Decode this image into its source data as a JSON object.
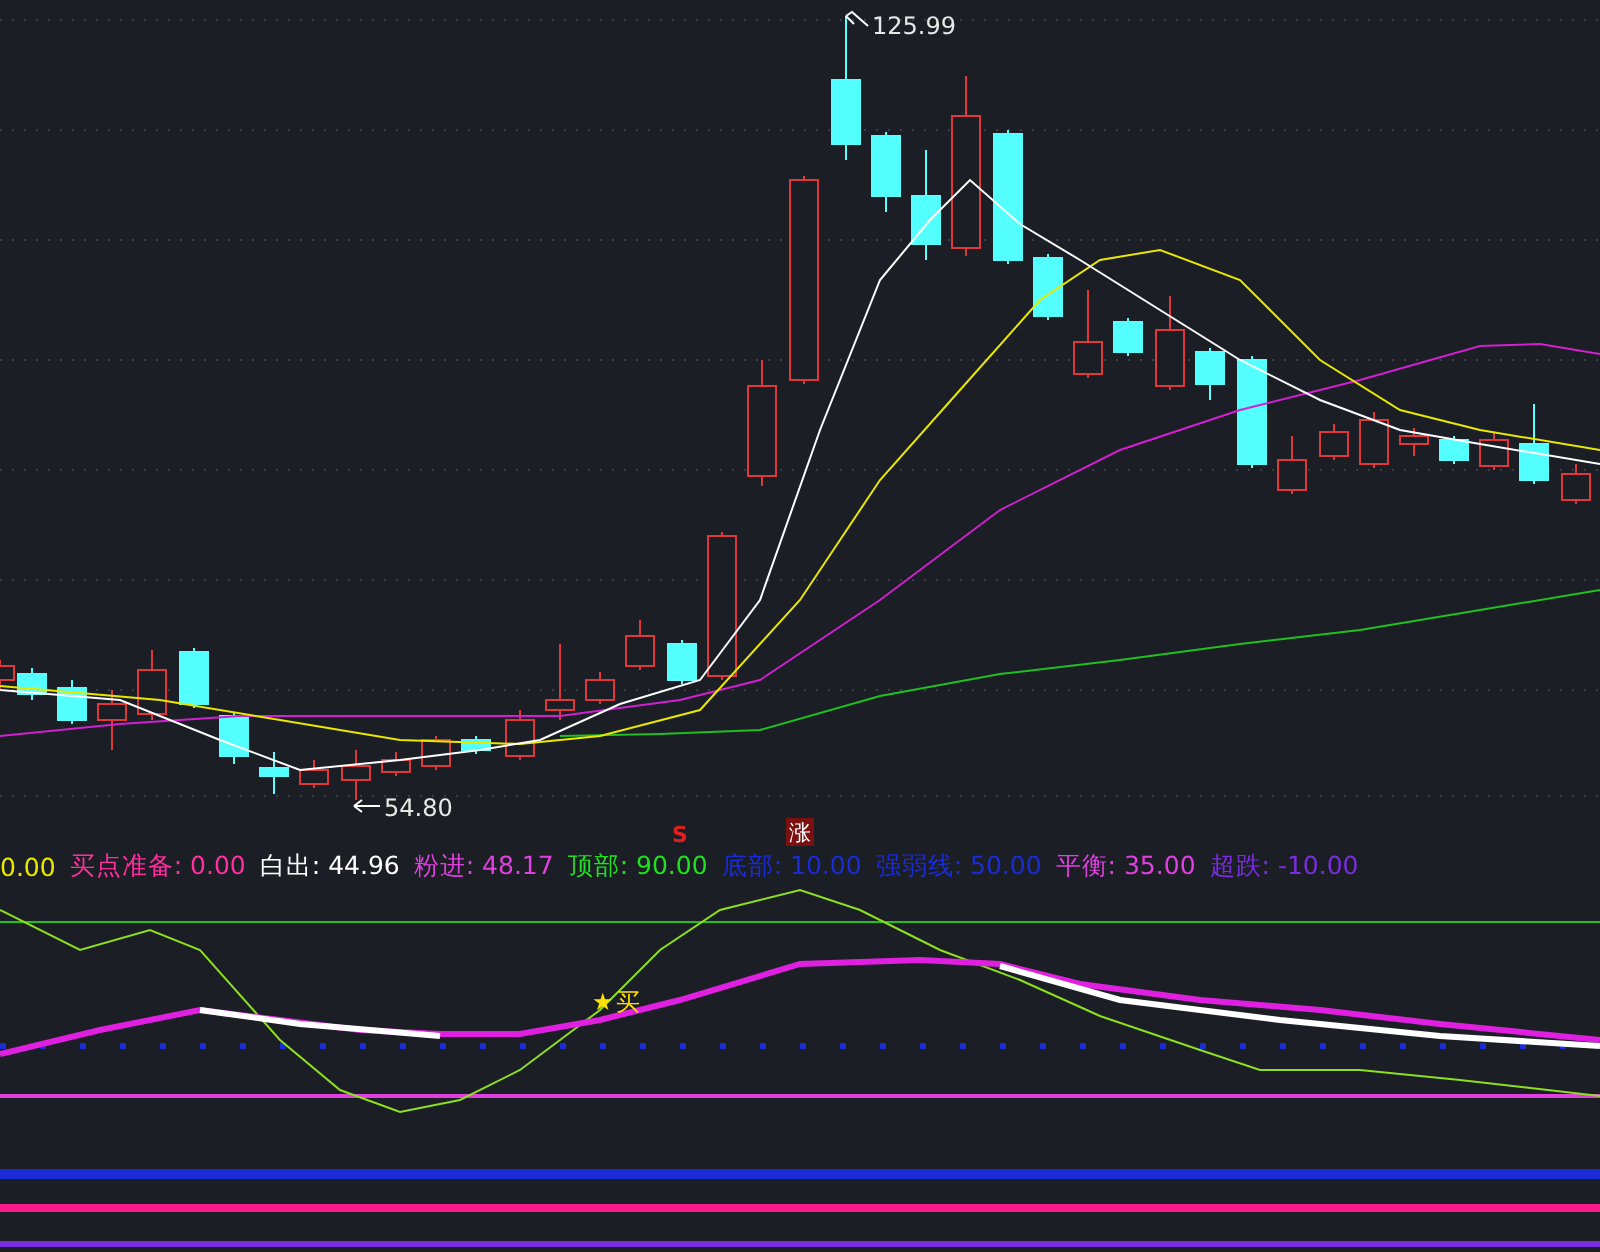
{
  "price_chart": {
    "high_label": "125.99",
    "low_label": "54.80",
    "signals": [
      {
        "kind": "sell",
        "text": "S"
      },
      {
        "kind": "rise",
        "text": "涨"
      }
    ]
  },
  "legend": [
    {
      "value": "0.00",
      "color": "#e8e800"
    },
    {
      "label": "买点准备:",
      "value": "0.00",
      "color": "#ff2fa0"
    },
    {
      "label": "白出:",
      "value": "44.96",
      "color": "#ffffff"
    },
    {
      "label": "粉进:",
      "value": "48.17",
      "color": "#e040e0"
    },
    {
      "label": "顶部:",
      "value": "90.00",
      "color": "#20e020"
    },
    {
      "label": "底部:",
      "value": "10.00",
      "color": "#1a2cd8"
    },
    {
      "label": "强弱线:",
      "value": "50.00",
      "color": "#1a2cd8"
    },
    {
      "label": "平衡:",
      "value": "35.00",
      "color": "#e040e0"
    },
    {
      "label": "超跌:",
      "value": "-10.00",
      "color": "#7a2ce0"
    }
  ],
  "indicator": {
    "buy_marker": {
      "symbol": "★",
      "text": "买"
    }
  }
}
